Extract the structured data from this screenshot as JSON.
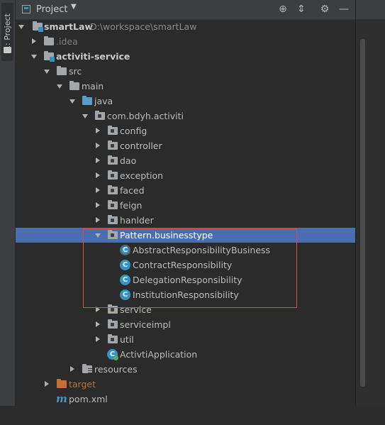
{
  "side_tab": {
    "label": "1: Project"
  },
  "header": {
    "title": "Project",
    "tools": {
      "locate": "⊕",
      "collapse": "⇕",
      "settings": "⚙",
      "minimize": "—"
    }
  },
  "tree": {
    "rows": [
      {
        "label": "smartLaw",
        "path": "D:\\workspace\\smartLaw"
      },
      {
        "label": ".idea"
      },
      {
        "label": "activiti-service"
      },
      {
        "label": "src"
      },
      {
        "label": "main"
      },
      {
        "label": "java"
      },
      {
        "label": "com.bdyh.activiti"
      },
      {
        "label": "config"
      },
      {
        "label": "controller"
      },
      {
        "label": "dao"
      },
      {
        "label": "exception"
      },
      {
        "label": "faced"
      },
      {
        "label": "feign"
      },
      {
        "label": "hanlder"
      },
      {
        "label": "Pattern.businesstype"
      },
      {
        "label": "AbstractResponsibilityBusiness",
        "badge": "C"
      },
      {
        "label": "ContractResponsibility",
        "badge": "C"
      },
      {
        "label": "DelegationResponsibility",
        "badge": "C"
      },
      {
        "label": "InstitutionResponsibility",
        "badge": "C"
      },
      {
        "label": "service"
      },
      {
        "label": "serviceimpl"
      },
      {
        "label": "util"
      },
      {
        "label": "ActivtiApplication",
        "badge": "C"
      },
      {
        "label": "resources"
      },
      {
        "label": "target"
      },
      {
        "label": "pom.xml",
        "badge": "m"
      }
    ]
  },
  "colors": {
    "background": "#2b2b2b",
    "selection": "#4b6eaf",
    "highlight_box": "#d84b4b",
    "class_icon": "#3592c4"
  }
}
